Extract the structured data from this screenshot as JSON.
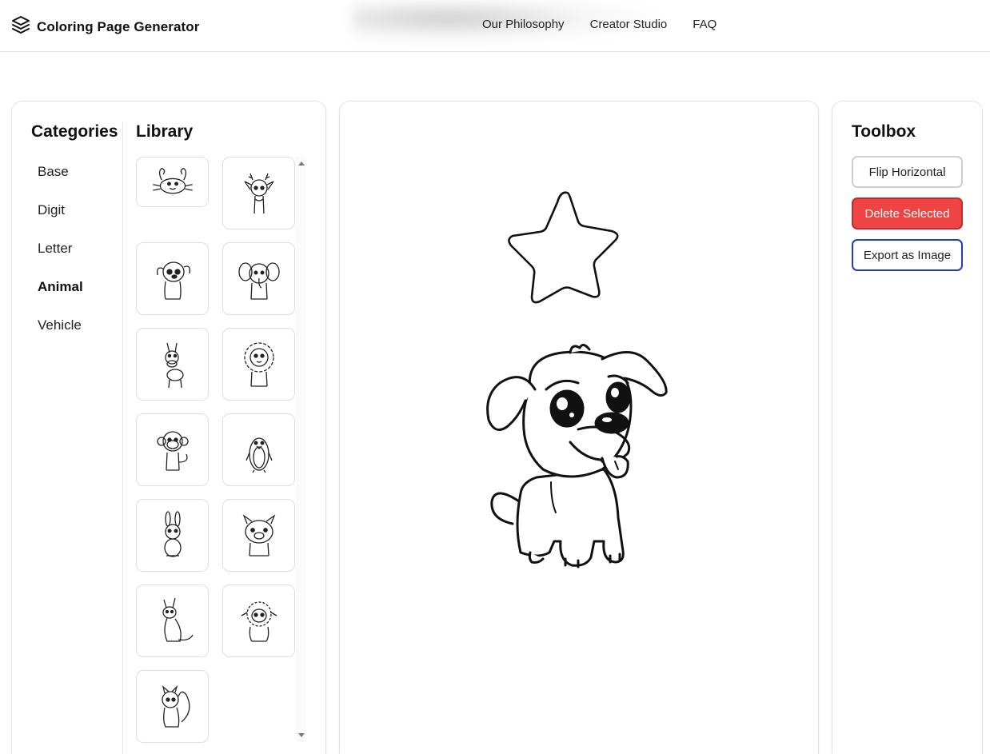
{
  "header": {
    "brand_title": "Coloring Page Generator",
    "brand_icon": "layers-icon",
    "nav": [
      "Our Philosophy",
      "Creator Studio",
      "FAQ"
    ]
  },
  "categories": {
    "title": "Categories",
    "items": [
      "Base",
      "Digit",
      "Letter",
      "Animal",
      "Vehicle"
    ],
    "active": "Animal"
  },
  "library": {
    "title": "Library",
    "items": [
      "crab",
      "deer",
      "puppy",
      "elephant",
      "donkey",
      "lion",
      "monkey",
      "penguin",
      "rabbit",
      "pig",
      "kangaroo",
      "sheep",
      "squirrel"
    ]
  },
  "canvas": {
    "objects": [
      "star",
      "puppy"
    ]
  },
  "toolbox": {
    "title": "Toolbox",
    "flip_label": "Flip Horizontal",
    "delete_label": "Delete Selected",
    "export_label": "Export as Image"
  },
  "colors": {
    "delete_bg": "#ef4444",
    "export_border": "#1e40af",
    "border": "#e4e4e4"
  }
}
